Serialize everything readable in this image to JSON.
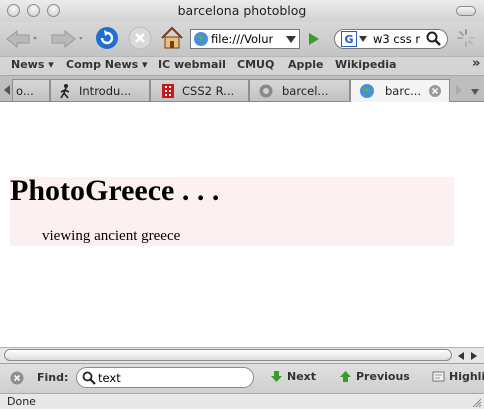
{
  "window": {
    "title": "barcelona photoblog"
  },
  "navbar": {
    "url": "file:///Volur",
    "search_value": "w3 css r",
    "search_engine_letter": "G"
  },
  "bookmarks": [
    {
      "label": "News ▾"
    },
    {
      "label": "Comp News ▾"
    },
    {
      "label": "IC webmail"
    },
    {
      "label": "CMUQ"
    },
    {
      "label": "Apple"
    },
    {
      "label": "Wikipedia"
    }
  ],
  "bookmarks_overflow": "»",
  "tabs": [
    {
      "label": "o..."
    },
    {
      "label": "Introdu..."
    },
    {
      "label": "CSS2 R..."
    },
    {
      "label": "barcel..."
    },
    {
      "label": "barc..."
    }
  ],
  "page": {
    "title": "PhotoGreece . . .",
    "subtitle": "viewing ancient greece",
    "header_bg": "#fdf0f1"
  },
  "findbar": {
    "label": "Find:",
    "value": "text",
    "next_label": "Next",
    "previous_label": "Previous",
    "highlight_label": "Highli"
  },
  "status": {
    "text": "Done"
  },
  "colors": {
    "arrow_green": "#3a9a2a",
    "reload_blue": "#1f6fd1"
  }
}
